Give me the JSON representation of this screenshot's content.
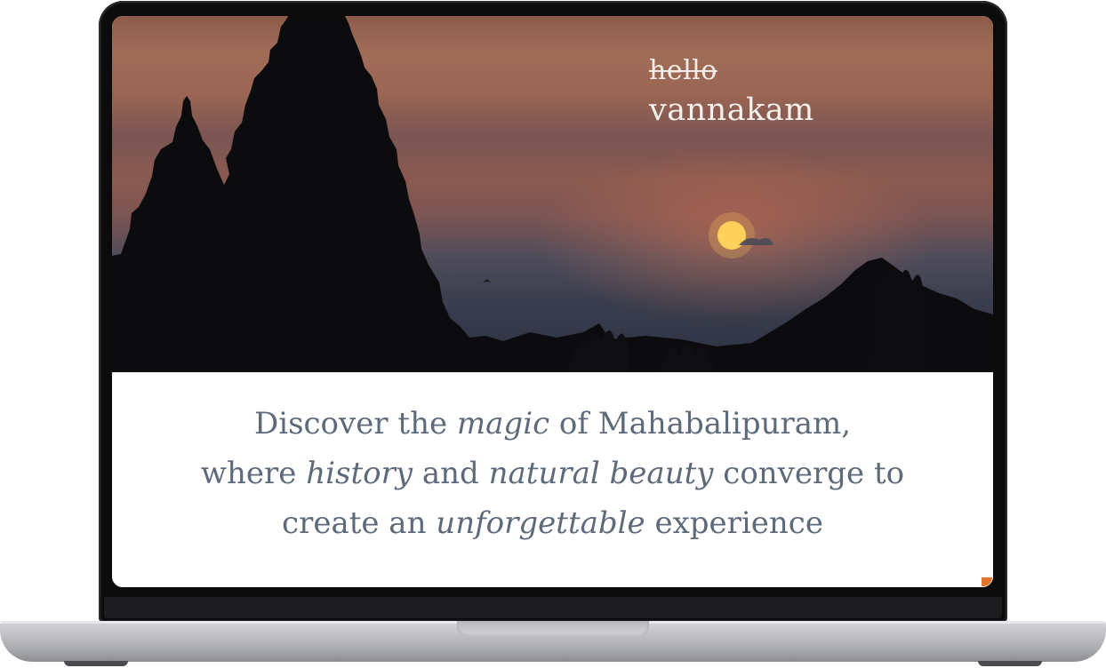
{
  "hero": {
    "greeting_struck": "hello",
    "greeting": "vannakam"
  },
  "tagline": {
    "l1_a": "Discover the ",
    "l1_em": "magic",
    "l1_b": " of Mahabalipuram,",
    "l2_a": "where ",
    "l2_em1": "history",
    "l2_b": " and ",
    "l2_em2": "natural beauty",
    "l2_c": " converge to",
    "l3_a": "create an ",
    "l3_em": "unforgettable",
    "l3_b": " experience"
  },
  "colors": {
    "tagline_text": "#5d6a7a",
    "accent": "#e2742c"
  }
}
